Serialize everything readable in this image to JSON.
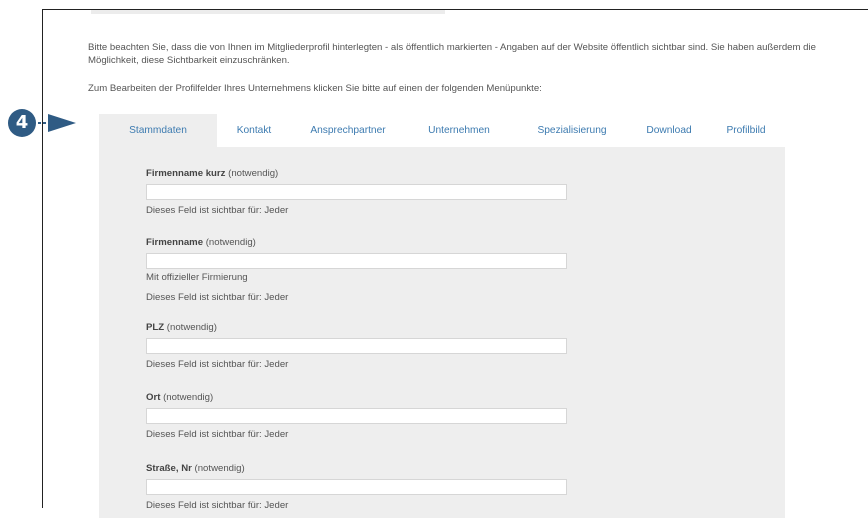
{
  "intro": {
    "line1": "Bitte beachten Sie, dass die von Ihnen im Mitgliederprofil hinterlegten - als öffentlich markierten - Angaben auf der Website öffentlich sichtbar sind. Sie haben außerdem die Möglichkeit, diese Sichtbarkeit einzuschränken.",
    "line2": "Zum Bearbeiten der Profilfelder Ihres Unternehmens klicken Sie bitte auf einen der folgenden Menüpunkte:"
  },
  "badge": {
    "number": "4",
    "color": "#2f5b84"
  },
  "tabs": [
    {
      "label": "Stammdaten",
      "active": true
    },
    {
      "label": "Kontakt"
    },
    {
      "label": "Ansprechpartner"
    },
    {
      "label": "Unternehmen"
    },
    {
      "label": "Spezialisierung"
    },
    {
      "label": "Download"
    },
    {
      "label": "Profilbild"
    }
  ],
  "fields": [
    {
      "name": "Firmenname kurz",
      "req": "(notwendig)",
      "hint": "Dieses Feld ist sichtbar für: Jeder"
    },
    {
      "name": "Firmenname",
      "req": "(notwendig)",
      "note": "Mit offizieller Firmierung",
      "hint": "Dieses Feld ist sichtbar für: Jeder"
    },
    {
      "name": "PLZ",
      "req": "(notwendig)",
      "hint": "Dieses Feld ist sichtbar für: Jeder"
    },
    {
      "name": "Ort",
      "req": "(notwendig)",
      "hint": "Dieses Feld ist sichtbar für: Jeder"
    },
    {
      "name": "Straße, Nr",
      "req": "(notwendig)",
      "hint": "Dieses Feld ist sichtbar für: Jeder"
    }
  ],
  "colors": {
    "tab_link": "#3d7bb0",
    "panel_bg": "#eeeeee",
    "accent": "#2f5b84"
  }
}
